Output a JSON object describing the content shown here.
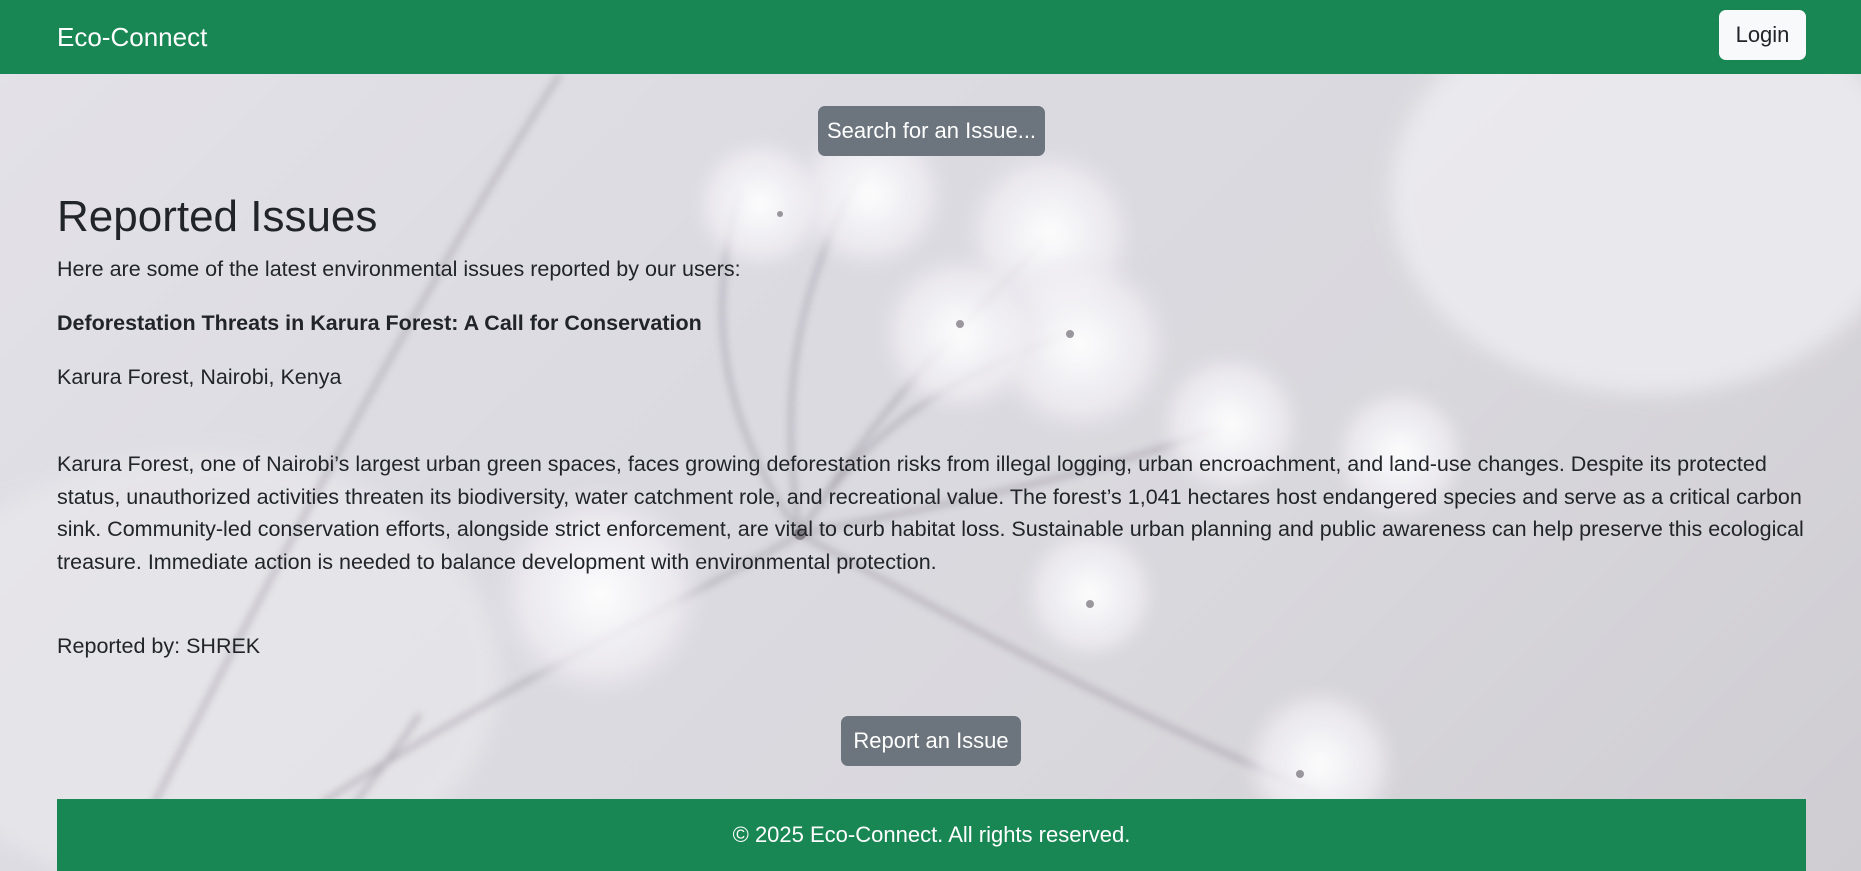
{
  "navbar": {
    "brand": "Eco-Connect",
    "login_label": "Login"
  },
  "search": {
    "button_label": "Search for an Issue..."
  },
  "main": {
    "title": "Reported Issues",
    "intro": "Here are some of the latest environmental issues reported by our users:",
    "issues": [
      {
        "title": "Deforestation Threats in Karura Forest: A Call for Conservation",
        "location": "Karura Forest, Nairobi, Kenya",
        "description": "Karura Forest, one of Nairobi’s largest urban green spaces, faces growing deforestation risks from illegal logging, urban encroachment, and land-use changes. Despite its protected status, unauthorized activities threaten its biodiversity, water catchment role, and recreational value. The forest’s 1,041 hectares host endangered species and serve as a critical carbon sink. Community-led conservation efforts, alongside strict enforcement, are vital to curb habitat loss. Sustainable urban planning and public awareness can help preserve this ecological treasure. Immediate action is needed to balance development with environmental protection.",
        "reported_by": "Reported by: SHREK"
      }
    ],
    "report_button_label": "Report an Issue"
  },
  "footer": {
    "text": "© 2025 Eco-Connect. All rights reserved."
  },
  "colors": {
    "primary_green": "#198754",
    "secondary_gray": "#6c757d",
    "light_button": "#f8f9fa",
    "text_dark": "#212529"
  }
}
